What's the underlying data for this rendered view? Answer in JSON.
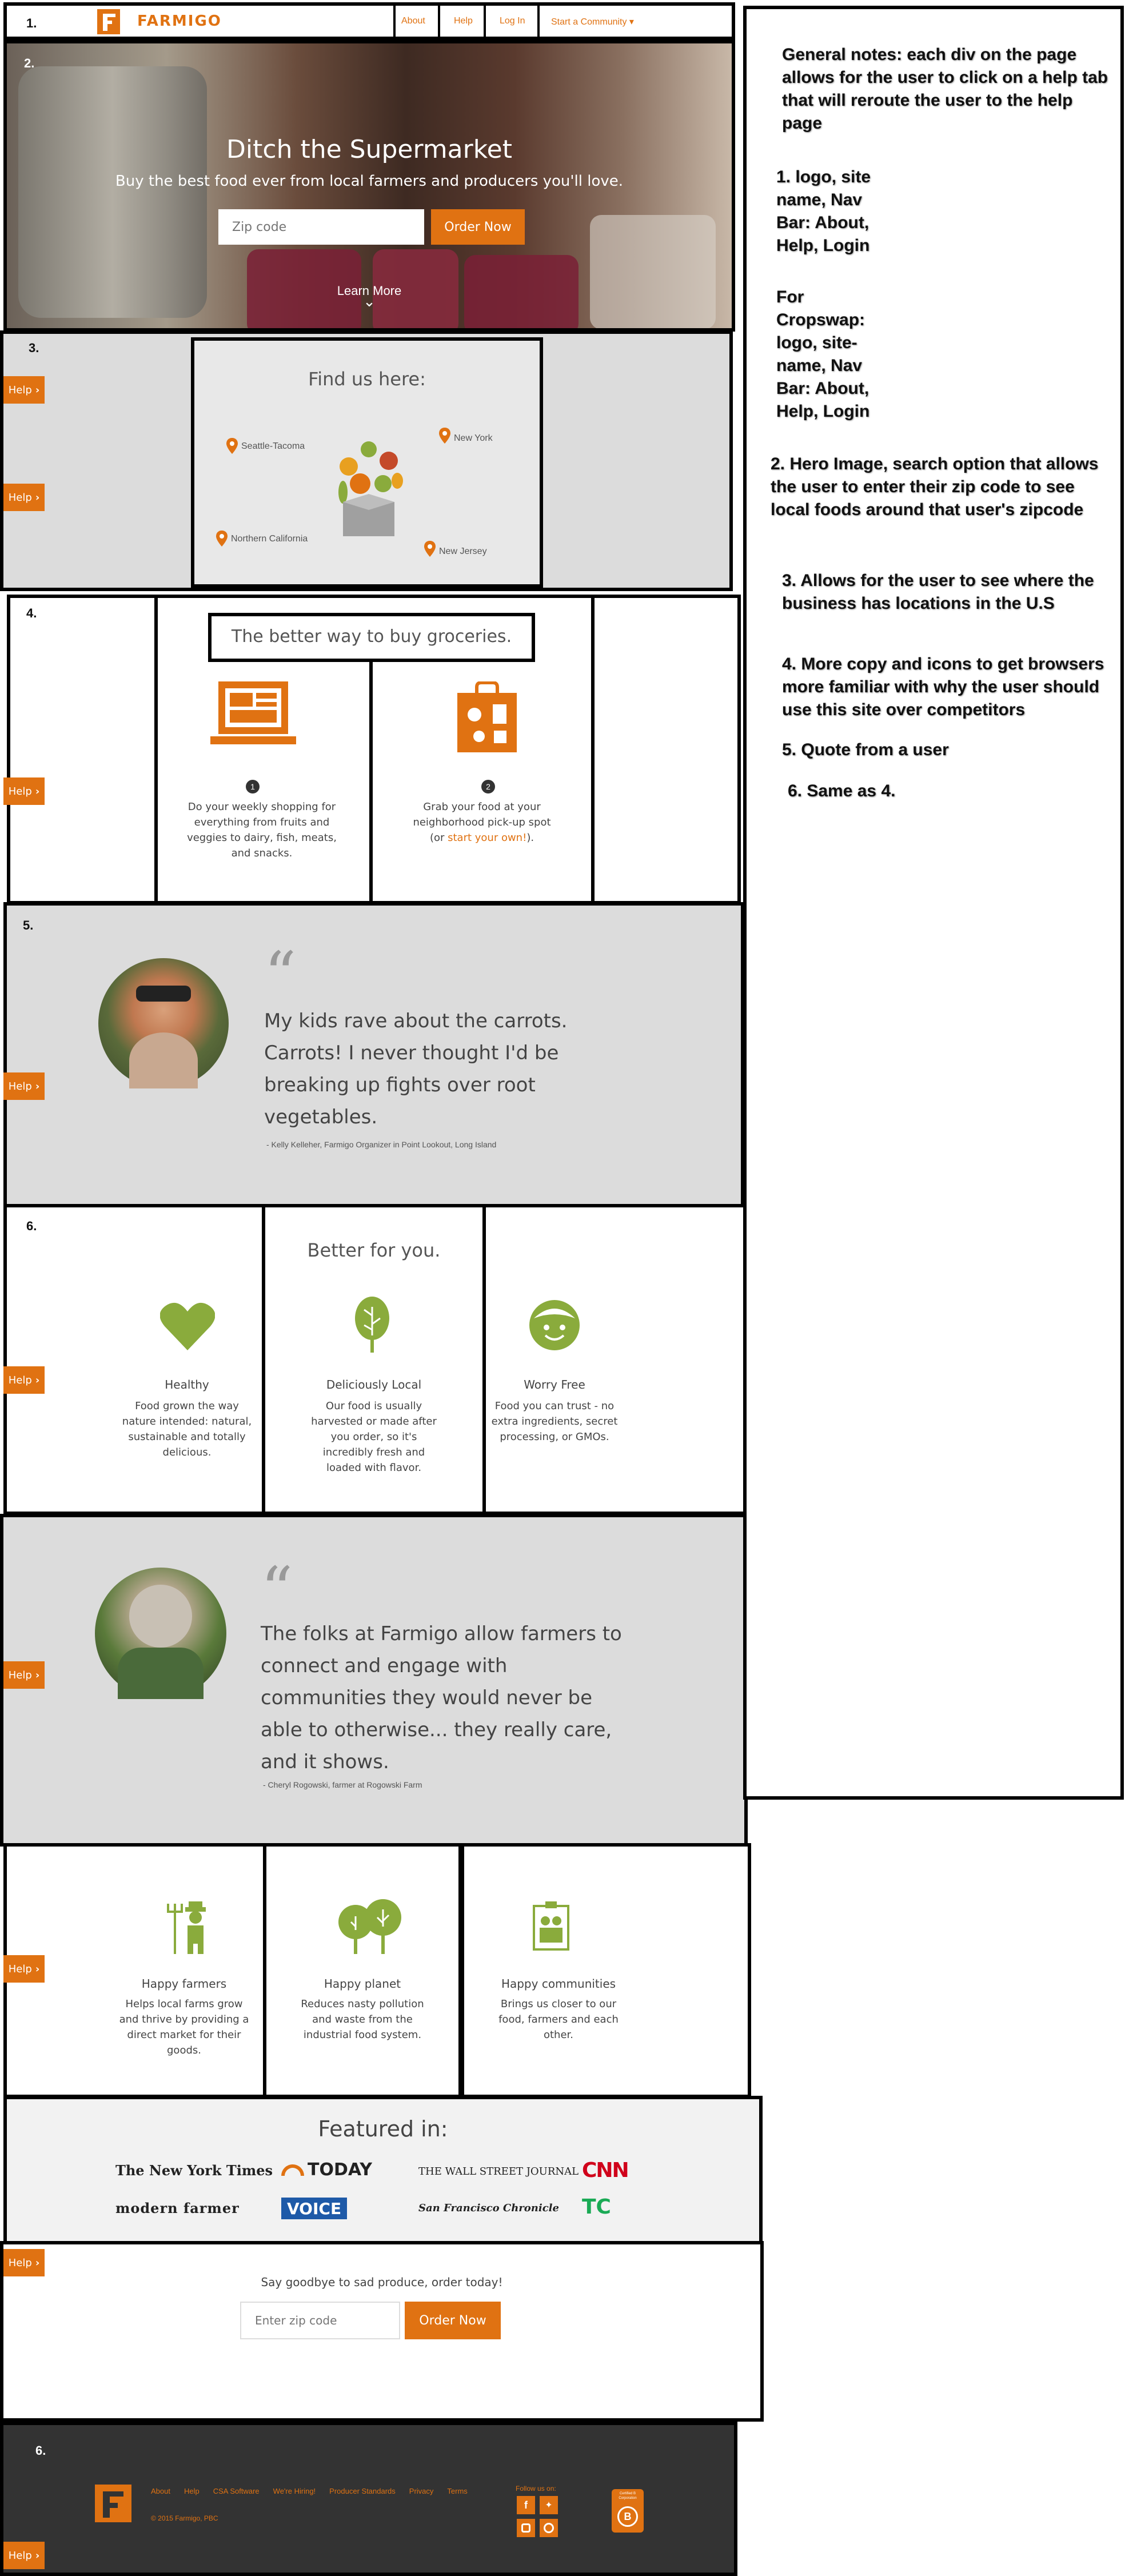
{
  "header": {
    "section_num": "1.",
    "site_name": "FARMIGO",
    "nav": [
      "About",
      "Help",
      "Log In",
      "Start a Community ▾"
    ]
  },
  "hero": {
    "section_num": "2.",
    "title": "Ditch the Supermarket",
    "subtitle": "Buy the best food ever from local farmers and producers you'll love.",
    "zip_placeholder": "Zip code",
    "order_button": "Order Now",
    "learn_more": "Learn More",
    "learn_more_chevron": "⌄"
  },
  "locations": {
    "section_num": "3.",
    "title": "Find us here:",
    "places": [
      "Seattle-Tacoma",
      "New York",
      "Northern California",
      "New Jersey"
    ]
  },
  "better_way": {
    "section_num": "4.",
    "title": "The better way to buy groceries.",
    "steps": [
      {
        "number": "1",
        "text_lines": [
          "Do your weekly shopping for",
          "everything from fruits and",
          "veggies to dairy, fish, meats,",
          "and snacks."
        ]
      },
      {
        "number": "2",
        "text_lines": [
          "Grab your food at your",
          "neighborhood pick-up spot"
        ],
        "text_prefix": "(or ",
        "link": "start your own!",
        "text_suffix": ")."
      }
    ]
  },
  "quote1": {
    "section_num": "5.",
    "quote_lines": [
      "My kids rave about the carrots.",
      "Carrots! I never thought I'd be",
      "breaking up fights over root",
      "vegetables."
    ],
    "attribution": "- Kelly Kelleher, Farmigo Organizer in Point Lookout, Long Island"
  },
  "better_for_you": {
    "section_num": "6.",
    "title": "Better for you.",
    "features": [
      {
        "icon": "heart-icon",
        "title": "Healthy",
        "lines": [
          "Food grown the way",
          "nature intended: natural,",
          "sustainable and totally",
          "delicious."
        ]
      },
      {
        "icon": "leaf-icon",
        "title": "Deliciously Local",
        "lines": [
          "Our food is usually",
          "harvested or made after",
          "you order, so it's",
          "incredibly fresh and",
          "loaded with flavor."
        ]
      },
      {
        "icon": "smiley-icon",
        "title": "Worry Free",
        "lines": [
          "Food you can trust - no",
          "extra ingredients, secret",
          "processing, or GMOs."
        ]
      }
    ]
  },
  "quote2": {
    "quote_lines": [
      "The folks at Farmigo allow farmers to",
      "connect and engage with",
      "communities they would never be",
      "able to otherwise... they really care,",
      "and it shows."
    ],
    "attribution": "- Cheryl Rogowski, farmer at Rogowski Farm"
  },
  "happy": {
    "features": [
      {
        "icon": "farmer-icon",
        "title": "Happy farmers",
        "lines": [
          "Helps local farms grow",
          "and thrive by providing a",
          "direct market for their",
          "goods."
        ]
      },
      {
        "icon": "trees-icon",
        "title": "Happy planet",
        "lines": [
          "Reduces nasty pollution",
          "and waste from the",
          "industrial food system."
        ]
      },
      {
        "icon": "community-icon",
        "title": "Happy communities",
        "lines": [
          "Brings us closer to our",
          "food, farmers and each",
          "other."
        ]
      }
    ]
  },
  "featured": {
    "title": "Featured in:",
    "logos": [
      "The New York Times",
      "TODAY",
      "THE WALL STREET JOURNAL",
      "CNN",
      "modern farmer",
      "VOICE",
      "San Francisco Chronicle",
      "TC"
    ]
  },
  "cta": {
    "text": "Say goodbye to sad produce, order today!",
    "zip_placeholder": "Enter zip code",
    "order_button": "Order Now"
  },
  "footer": {
    "section_num": "6.",
    "links": [
      "About",
      "Help",
      "CSA Software",
      "We're Hiring!",
      "Producer Standards",
      "Privacy",
      "Terms"
    ],
    "copyright": "© 2015 Farmigo, PBC",
    "follow": "Follow us on:",
    "bcorp": "Certified B Corporation"
  },
  "help_label": "Help",
  "notes": {
    "general": "General notes:  each div on the page allows for the user to click on a help tab that will reroute the user to the help page",
    "n1": "1. logo, site name, Nav Bar:  About, Help, Login",
    "n1b": "For Cropswap: logo, site-name, Nav Bar: About, Help, Login",
    "n2": "2. Hero Image, search option that allows the user to enter their zip code to see local foods around that user's zipcode",
    "n3": "3.  Allows for the user to see where the business has locations in the U.S",
    "n4": "4. More copy and icons to get browsers more familiar with why the user should use this site over competitors",
    "n5": "5. Quote from a user",
    "n6": "6. Same as 4."
  },
  "colors": {
    "accent": "#e07212",
    "green": "#8aab3c",
    "gray_bg": "#dcdcdc",
    "footer_bg": "#333333"
  }
}
